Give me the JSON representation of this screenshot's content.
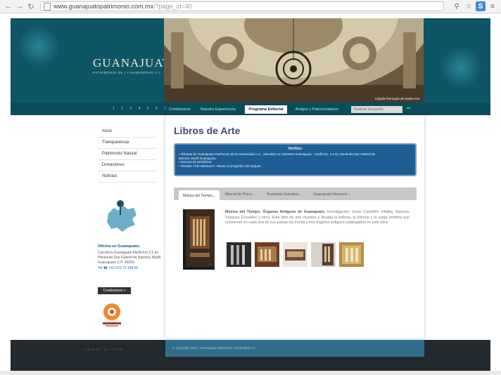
{
  "browser": {
    "url_host": "www.guanajuatopatrimonio.com.mx",
    "url_path": "/?page_id=40",
    "icons": [
      "back-icon",
      "forward-icon",
      "reload-icon",
      "zoom-icon",
      "star-icon",
      "extension-icon",
      "menu-icon"
    ]
  },
  "header": {
    "logo_title": "GUANAJUATO",
    "logo_subtitle": "PATRIMONIO DE LA HUMANIDAD A.C.",
    "hero_caption": "Cúpula Parroquia de Santa Ana"
  },
  "pager": "1 2 3 4 5 6 7",
  "topnav": {
    "tabs": [
      "Contáctanos",
      "Nuestra Experiencia",
      "Programa Editorial",
      "Amigos y Patrocinadores"
    ],
    "active_index": 2
  },
  "search": {
    "placeholder": "Realizar búsqueda"
  },
  "sidebar": {
    "items": [
      "Inicio",
      "Transparencia",
      "Patrimonio Natural",
      "Donaciones",
      "Noticias"
    ],
    "office": {
      "title": "Oficina en Guanajuato:",
      "address": "Carretera Guanajuato Marfil Km 2.5 Ex Hacienda San Gabriel de Barrera, Marfil, Guanajuato C.P. 36090.",
      "phone_label": "Tel",
      "phone": "+52 473 73 184 56"
    },
    "contact_button": "Contáctenos »"
  },
  "main": {
    "title": "Libros de Arte",
    "ventas": {
      "heading": "Ventas:",
      "lines": [
        "• Oficinas de Guanajuato Patrimonio de la Humanidad A.C., ubicadas en Carretera Guanajuato - marfil Km. 2.5 Ex Hacienda San Gabriel de",
        "  Barrera, Marfil Guanajuato.",
        "• Kioscos de periódicos",
        "• Tiendas \"Arte Mexicano\", Museo Iconográfico del Quijote."
      ]
    },
    "book_tabs": [
      "Música del Tiempo...",
      "Mineral de Pozos...",
      "Resonada Grandeza...",
      "Guanajuato Horizonte..."
    ],
    "book": {
      "title": "Música del Tiempo. Órganos Antiguos de Guanajuato.",
      "body": "Investigación: Jonas Castellón Villalba, Mauricio Vázquez González y otros. Este libro de arte muestra y divulga la belleza, la historia y la carga emotiva que conservan en cada una de sus piezas los treinta y tres órganos antiguos catalogados en este obra."
    }
  },
  "footer": {
    "copyright": "© Copyright 2013 - Guanajuato Patrimonio Humanidad A.C.",
    "left_text": "ABOUT & INFO"
  },
  "colors": {
    "header_teal": "#0e5566",
    "ventas_blue": "#1d5f94",
    "title_blue": "#3a4a7a",
    "footer_dark": "#222a30"
  }
}
